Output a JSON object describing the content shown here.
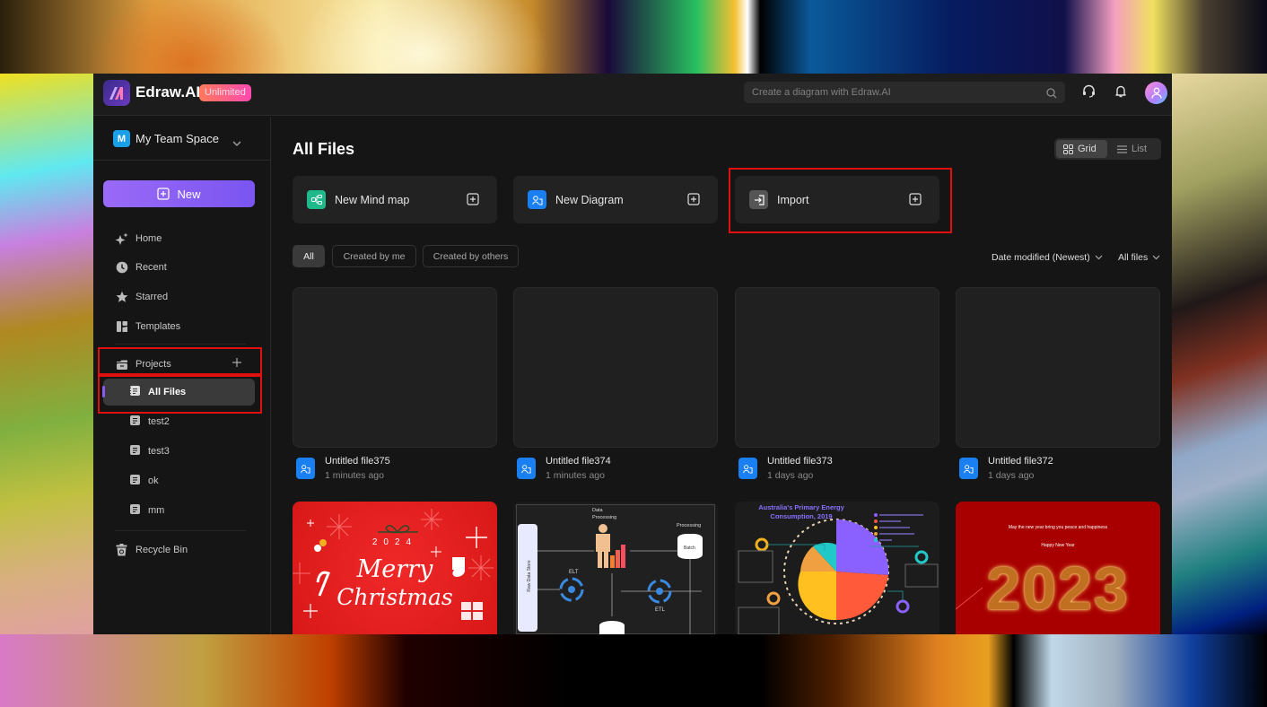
{
  "app": {
    "brand": "Edraw.AI",
    "plan_badge": "Unlimited",
    "search_placeholder": "Create a diagram with Edraw.AI"
  },
  "sidebar": {
    "team_initial": "M",
    "team_name": "My Team Space",
    "new_label": "New",
    "nav": [
      {
        "label": "Home",
        "icon": "sparkle-icon"
      },
      {
        "label": "Recent",
        "icon": "clock-icon"
      },
      {
        "label": "Starred",
        "icon": "star-icon"
      },
      {
        "label": "Templates",
        "icon": "templates-icon"
      }
    ],
    "projects_label": "Projects",
    "projects": [
      {
        "label": "All Files",
        "active": true
      },
      {
        "label": "test2"
      },
      {
        "label": "test3"
      },
      {
        "label": "ok"
      },
      {
        "label": "mm"
      }
    ],
    "recycle_label": "Recycle Bin"
  },
  "main": {
    "title": "All Files",
    "view_grid": "Grid",
    "view_list": "List",
    "actions": [
      {
        "label": "New Mind map",
        "color": "#1fb88a"
      },
      {
        "label": "New Diagram",
        "color": "#1a7ff0"
      },
      {
        "label": "Import",
        "color": "#555555"
      }
    ],
    "filters": [
      "All",
      "Created by me",
      "Created by others"
    ],
    "sort_label": "Date modified (Newest)",
    "scope_label": "All files",
    "files": [
      {
        "name": "Untitled file375",
        "time": "1 minutes ago"
      },
      {
        "name": "Untitled file374",
        "time": "1 minutes ago"
      },
      {
        "name": "Untitled file373",
        "time": "1 days ago"
      },
      {
        "name": "Untitled file372",
        "time": "1 days ago"
      }
    ],
    "templates": [
      {
        "year": "2024",
        "line1": "Merry",
        "line2": "Christmas"
      },
      {
        "title": "Data Processing",
        "label_store": "Raw Data Store",
        "label_etl": "ETL",
        "label_elt": "ELT",
        "label_batch": "Batch",
        "label_proc": "Processing"
      },
      {
        "title_line1": "Australia's Primary Energy",
        "title_line2": "Consumption, 2019"
      },
      {
        "line1": "May the new year bring you peace and happiness",
        "line2": "Happy New Year",
        "year": "2023"
      }
    ]
  },
  "highlight_color": "#e01010"
}
